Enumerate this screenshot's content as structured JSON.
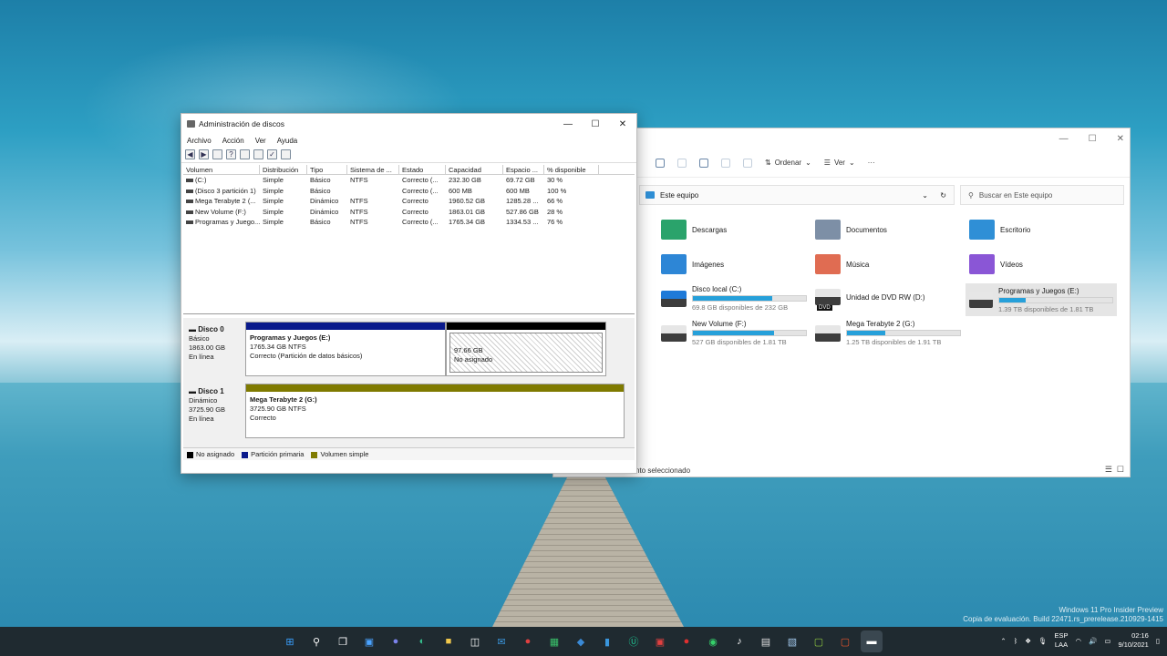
{
  "desktop": {
    "watermark_line1": "Windows 11 Pro Insider Preview",
    "watermark_line2": "Copia de evaluación. Build 22471.rs_prerelease.210929-1415"
  },
  "explorer": {
    "toolbar": {
      "sort_label": "Ordenar",
      "view_label": "Ver",
      "more": "···"
    },
    "address": "Este equipo",
    "search_placeholder": "Buscar en Este equipo",
    "folders": [
      {
        "label": "Descargas",
        "color": "#2aa36b"
      },
      {
        "label": "Documentos",
        "color": "#7d8fa6"
      },
      {
        "label": "Escritorio",
        "color": "#2f8fd6"
      },
      {
        "label": "Imágenes",
        "color": "#2d86d6"
      },
      {
        "label": "Música",
        "color": "#e06c52"
      },
      {
        "label": "Vídeos",
        "color": "#8a56d6"
      }
    ],
    "drives": [
      {
        "label": "Disco local (C:)",
        "sub": "69.8 GB disponibles de 232 GB",
        "used": 0.7
      },
      {
        "label": "Unidad de DVD RW (D:)",
        "sub": "",
        "used": 0,
        "badge": "DVD"
      },
      {
        "label": "Programas y Juegos (E:)",
        "sub": "1.39 TB disponibles de 1.81 TB",
        "used": 0.23
      },
      {
        "label": "New Volume (F:)",
        "sub": "527 GB disponibles de 1.81 TB",
        "used": 0.72
      },
      {
        "label": "Mega Terabyte 2 (G:)",
        "sub": "1.25 TB disponibles de 1.91 TB",
        "used": 0.34
      }
    ],
    "status": "nto seleccionado"
  },
  "diskmgmt": {
    "title": "Administración de discos",
    "menu": [
      "Archivo",
      "Acción",
      "Ver",
      "Ayuda"
    ],
    "columns": [
      "Volumen",
      "Distribución",
      "Tipo",
      "Sistema de ...",
      "Estado",
      "Capacidad",
      "Espacio ...",
      "% disponible"
    ],
    "rows": [
      [
        "(C:)",
        "Simple",
        "Básico",
        "NTFS",
        "Correcto (...",
        "232.30 GB",
        "69.72 GB",
        "30 %"
      ],
      [
        "(Disco 3 partición 1)",
        "Simple",
        "Básico",
        "",
        "Correcto (...",
        "600 MB",
        "600 MB",
        "100 %"
      ],
      [
        "Mega Terabyte 2 (...",
        "Simple",
        "Dinámico",
        "NTFS",
        "Correcto",
        "1960.52 GB",
        "1285.28 ...",
        "66 %"
      ],
      [
        "New Volume (F:)",
        "Simple",
        "Dinámico",
        "NTFS",
        "Correcto",
        "1863.01 GB",
        "527.86 GB",
        "28 %"
      ],
      [
        "Programas y Juego...",
        "Simple",
        "Básico",
        "NTFS",
        "Correcto (...",
        "1765.34 GB",
        "1334.53 ...",
        "76 %"
      ]
    ],
    "disks": [
      {
        "name": "Disco 0",
        "type": "Básico",
        "size": "1863.00 GB",
        "state": "En línea",
        "partitions": [
          {
            "title": "Programas y Juegos  (E:)",
            "line2": "1765.34 GB NTFS",
            "line3": "Correcto (Partición de datos básicos)"
          },
          {
            "title": "",
            "line2": "97.66 GB",
            "line3": "No asignado"
          }
        ]
      },
      {
        "name": "Disco 1",
        "type": "Dinámico",
        "size": "3725.90 GB",
        "state": "En línea",
        "partitions": [
          {
            "title": "Mega Terabyte 2  (G:)",
            "line2": "3725.90 GB NTFS",
            "line3": "Correcto"
          }
        ]
      }
    ],
    "legend": [
      {
        "label": "No asignado",
        "color": "#000000"
      },
      {
        "label": "Partición primaria",
        "color": "#0a1a8c"
      },
      {
        "label": "Volumen simple",
        "color": "#7f7a00"
      }
    ]
  },
  "taskbar": {
    "lang_line1": "ESP",
    "lang_line2": "LAA",
    "time": "02:16",
    "date": "9/10/2021"
  }
}
